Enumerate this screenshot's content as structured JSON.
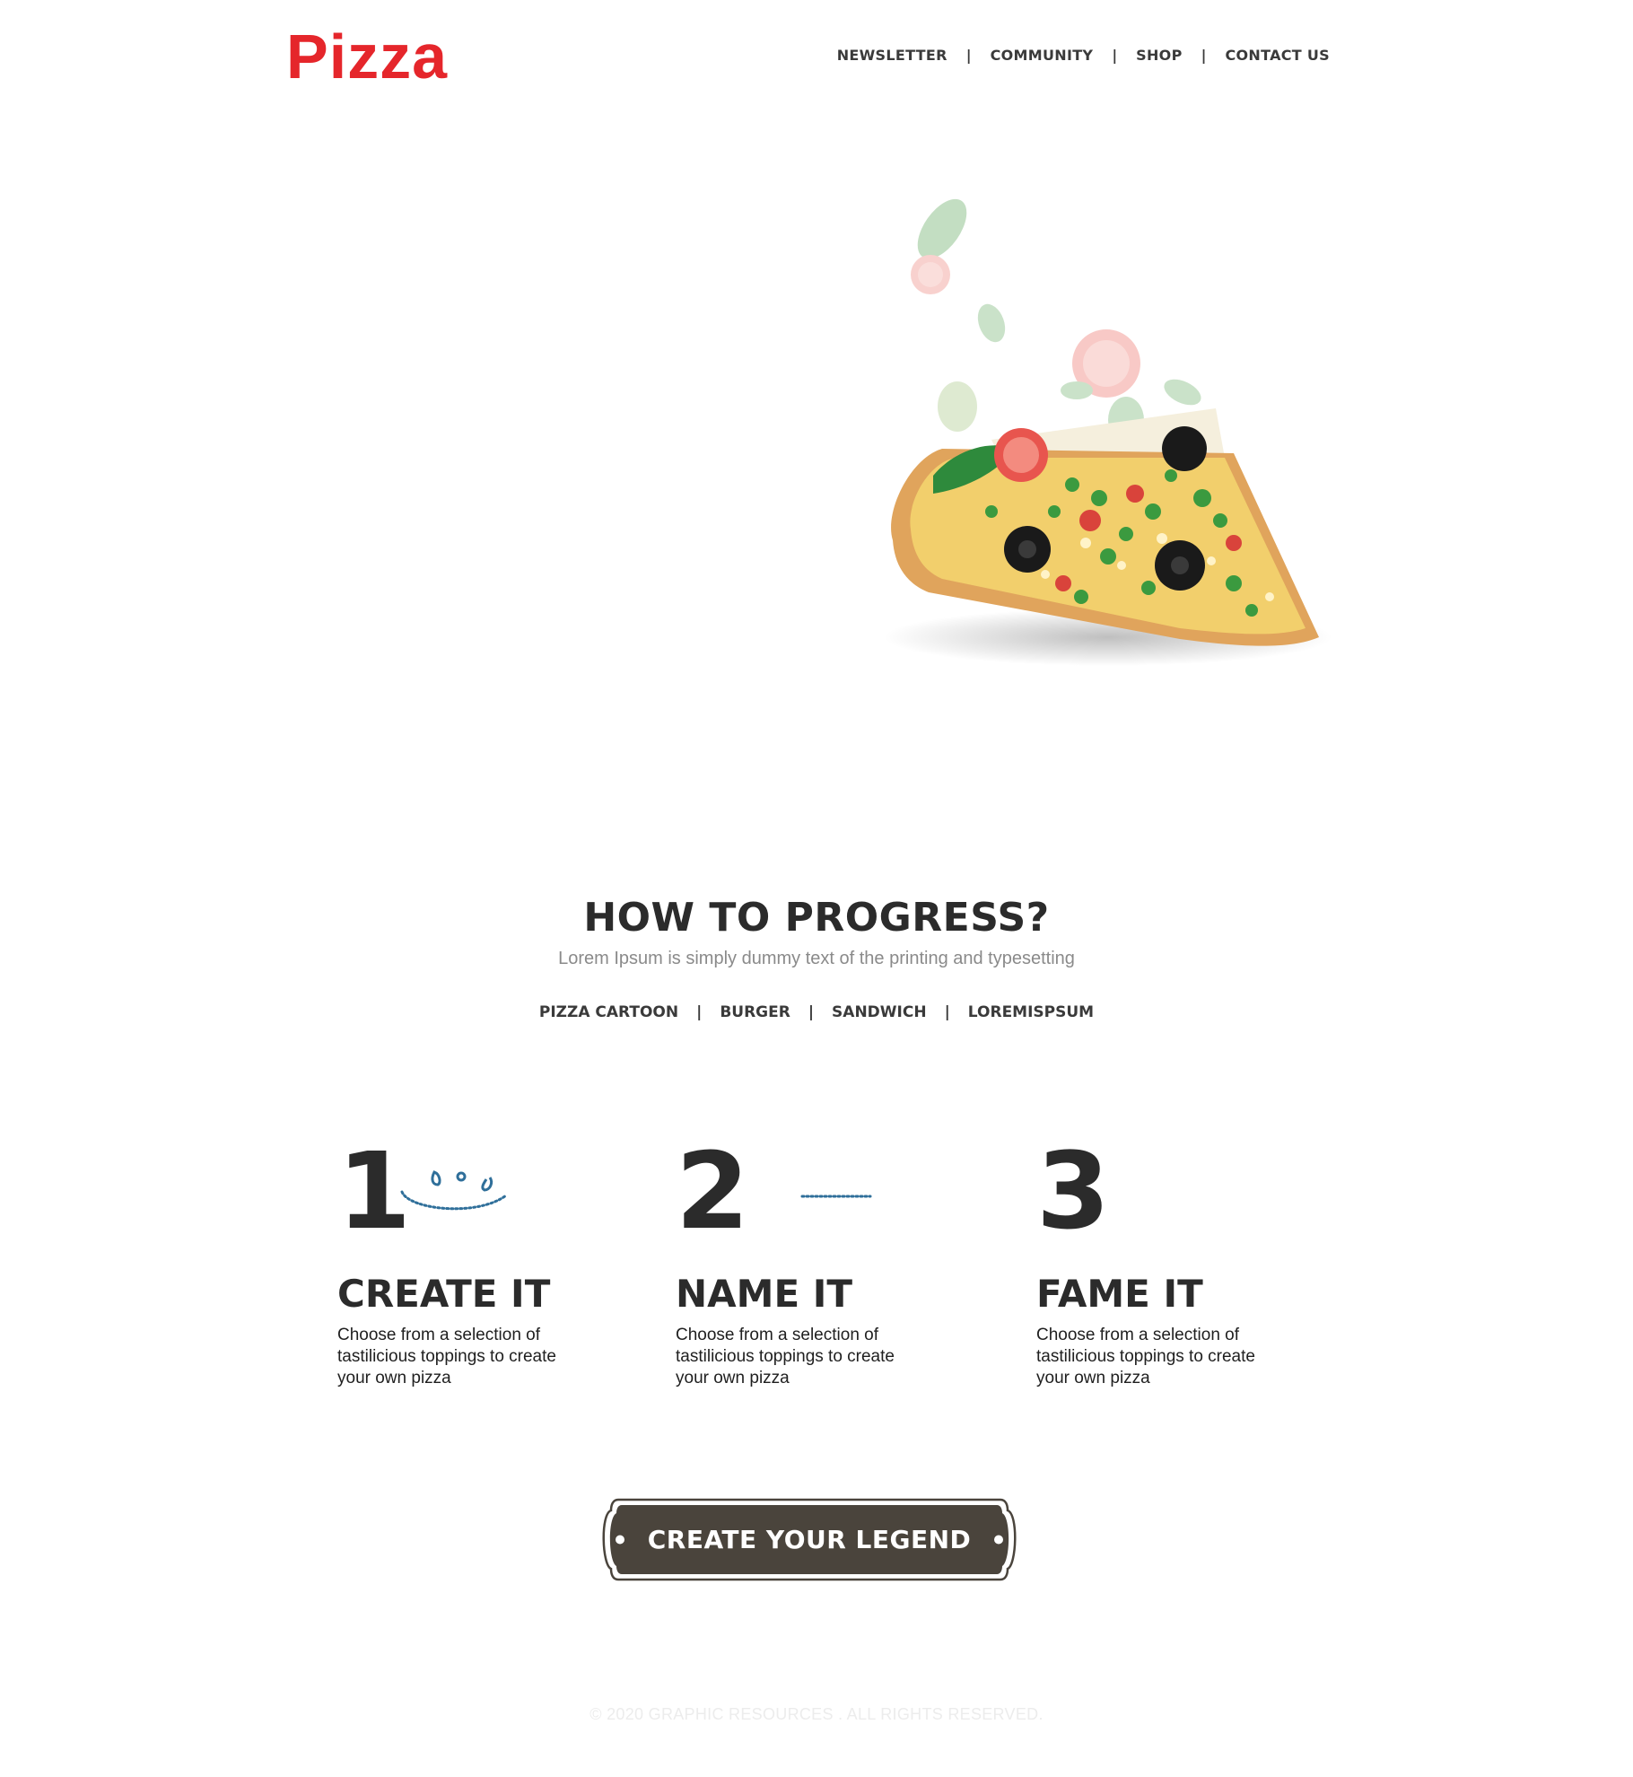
{
  "brand": {
    "logo_text": "Pizza",
    "color": "#e5262b"
  },
  "header": {
    "nav": [
      {
        "label": "NEWSLETTER"
      },
      {
        "label": "COMMUNITY"
      },
      {
        "label": "SHOP"
      },
      {
        "label": "CONTACT US"
      }
    ],
    "separator": "|"
  },
  "hero": {
    "image": "pizza-slice-with-falling-toppings"
  },
  "progress": {
    "title": "HOW TO PROGRESS?",
    "subtitle": "Lorem Ipsum is simply dummy text of the printing and typesetting",
    "categories": [
      {
        "label": "PIZZA CARTOON"
      },
      {
        "label": "BURGER"
      },
      {
        "label": "SANDWICH"
      },
      {
        "label": "LOREMISPSUM"
      }
    ],
    "steps": [
      {
        "number": "1",
        "title": "CREATE IT",
        "description": "Choose from a selection of tastilicious toppings to create your own pizza"
      },
      {
        "number": "2",
        "title": "NAME IT",
        "description": "Choose from a selection of tastilicious toppings to create your own pizza"
      },
      {
        "number": "3",
        "title": "FAME IT",
        "description": "Choose from a selection of tastilicious toppings to create your own pizza"
      }
    ]
  },
  "cta": {
    "label": "CREATE YOUR LEGEND",
    "color": "#4a443c"
  },
  "footer": {
    "text": "© 2020 GRAPHIC RESOURCES . ALL RIGHTS RESERVED."
  },
  "colors": {
    "text_dark": "#2b2b2b",
    "subtitle": "#8a8a8a",
    "deco_blue": "#2f6f9a"
  }
}
